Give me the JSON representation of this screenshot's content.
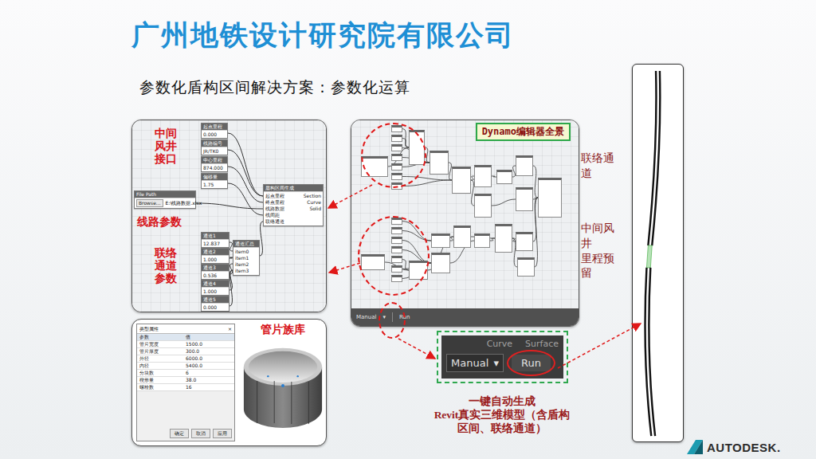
{
  "slide": {
    "title": "广州地铁设计研究院有限公司",
    "subtitle": "参数化盾构区间解决方案：参数化运算"
  },
  "left_graph": {
    "annotations": [
      {
        "lines": [
          "中间",
          "风井",
          "接口"
        ]
      },
      {
        "lines": [
          "线路参数"
        ]
      },
      {
        "lines": [
          "联络",
          "通道",
          "参数"
        ]
      }
    ],
    "inputs": [
      {
        "title": "起点里程",
        "value": "0.000"
      },
      {
        "title": "线路编号",
        "value": "JR/TK0"
      },
      {
        "title": "中心里程",
        "value": "874.000"
      },
      {
        "title": "偏移量",
        "value": "1.75"
      }
    ],
    "file_node": {
      "title": "File Path",
      "button": "Browse...",
      "value": "E:\\线路数据.xlsx"
    },
    "main_node": {
      "title": "盾构区间生成",
      "inputs": [
        "起点里程",
        "终点里程",
        "线路数据",
        "线间距",
        "联络通道"
      ],
      "outputs": [
        "Section",
        "Curve",
        "Solid"
      ]
    },
    "channel_inputs": [
      {
        "title": "通道1",
        "value": "12.837"
      },
      {
        "title": "通道2",
        "value": "1.000"
      },
      {
        "title": "通道3",
        "value": "0.536"
      },
      {
        "title": "通道4",
        "value": "1.000"
      },
      {
        "title": "通道5",
        "value": "0.000"
      }
    ],
    "merge_node": {
      "title": "通道汇总",
      "inputs": [
        "item0",
        "item1",
        "item2",
        "item3"
      ]
    }
  },
  "library_panel": {
    "label": "管片族库",
    "dialog": {
      "title": "类型属性",
      "close": "×",
      "columns": [
        "参数",
        "值"
      ],
      "rows": [
        {
          "name": "管片宽度",
          "value": "1500.0"
        },
        {
          "name": "管片厚度",
          "value": "300.0"
        },
        {
          "name": "外径",
          "value": "6000.0"
        },
        {
          "name": "内径",
          "value": "5400.0"
        },
        {
          "name": "分块数",
          "value": "6"
        },
        {
          "name": "楔形量",
          "value": "38.0"
        },
        {
          "name": "螺栓数",
          "value": "16"
        }
      ],
      "buttons": [
        "确定",
        "取消",
        "应用"
      ]
    }
  },
  "center_graph": {
    "label": "Dynamo编辑器全景",
    "bar": {
      "mode": "Manual",
      "arrow": "▾",
      "run": "Run"
    }
  },
  "zoom": {
    "tabs": [
      "Curve",
      "Surface"
    ],
    "mode": "Manual",
    "arrow": "▾",
    "run": "Run"
  },
  "caption": {
    "lines": [
      "一键自动生成",
      "Revit真实三维模型（含盾构",
      "区间、联络通道）"
    ]
  },
  "side_labels": [
    {
      "lines": [
        "联络通",
        "道"
      ]
    },
    {
      "lines": [
        "中间风",
        "井",
        "里程预",
        "留"
      ]
    }
  ],
  "logo": {
    "text": "AUTODESK."
  }
}
